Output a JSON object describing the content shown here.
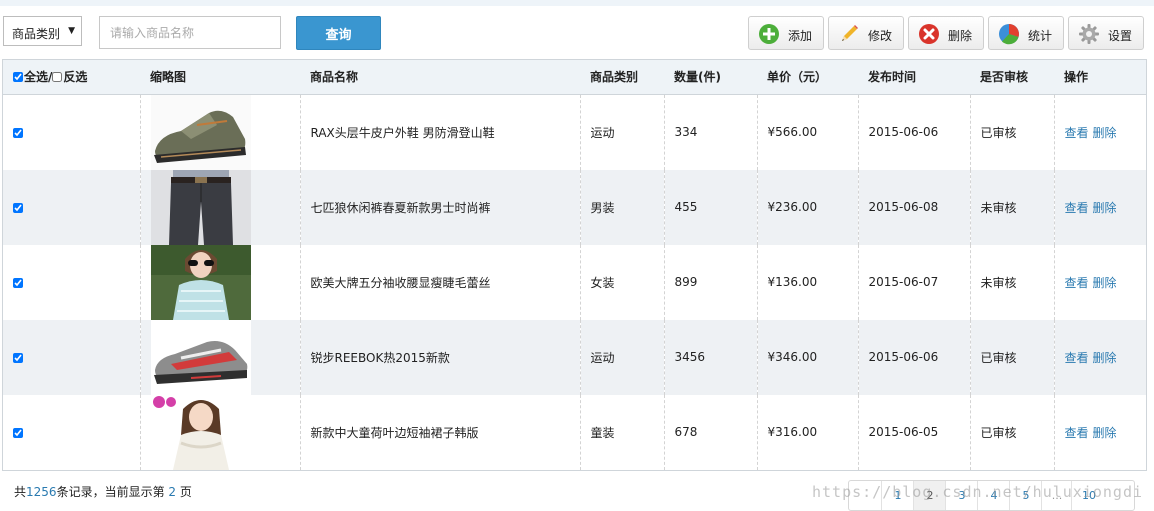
{
  "toolbar": {
    "category_select": {
      "value": "商品类别"
    },
    "search": {
      "placeholder": "请输入商品名称",
      "value": ""
    },
    "query_label": "查询",
    "buttons": [
      {
        "key": "add",
        "label": "添加",
        "icon": "plus-circle-icon"
      },
      {
        "key": "edit",
        "label": "修改",
        "icon": "pencil-icon"
      },
      {
        "key": "delete",
        "label": "删除",
        "icon": "x-circle-icon"
      },
      {
        "key": "stats",
        "label": "统计",
        "icon": "pie-chart-icon"
      },
      {
        "key": "settings",
        "label": "设置",
        "icon": "gear-icon"
      }
    ]
  },
  "table": {
    "headers": {
      "select_all": "全选/",
      "invert": "反选",
      "thumb": "缩略图",
      "name": "商品名称",
      "category": "商品类别",
      "qty": "数量(件)",
      "price": "单价（元）",
      "date": "发布时间",
      "audit": "是否审核",
      "ops": "操作"
    },
    "rows": [
      {
        "name": "RAX头层牛皮户外鞋 男防滑登山鞋",
        "category": "运动",
        "qty": "334",
        "price": "¥566.00",
        "date": "2015-06-06",
        "audit": "已审核",
        "view": "查看",
        "del": "删除"
      },
      {
        "name": "七匹狼休闲裤春夏新款男士时尚裤",
        "category": "男装",
        "qty": "455",
        "price": "¥236.00",
        "date": "2015-06-08",
        "audit": "未审核",
        "view": "查看",
        "del": "删除"
      },
      {
        "name": "欧美大牌五分袖收腰显瘦睫毛蕾丝",
        "category": "女装",
        "qty": "899",
        "price": "¥136.00",
        "date": "2015-06-07",
        "audit": "未审核",
        "view": "查看",
        "del": "删除"
      },
      {
        "name": "锐步REEBOK热2015新款",
        "category": "运动",
        "qty": "3456",
        "price": "¥346.00",
        "date": "2015-06-06",
        "audit": "已审核",
        "view": "查看",
        "del": "删除"
      },
      {
        "name": "新款中大童荷叶边短袖裙子韩版",
        "category": "童装",
        "qty": "678",
        "price": "¥316.00",
        "date": "2015-06-05",
        "audit": "已审核",
        "view": "查看",
        "del": "删除"
      }
    ]
  },
  "footer": {
    "prefix": "共",
    "total": "1256",
    "mid": "条记录，当前显示第",
    "current": "2",
    "suffix": "页"
  },
  "pagination": {
    "pages": [
      "1",
      "2",
      "3",
      "4",
      "5",
      "...",
      "10"
    ],
    "current": "2"
  },
  "watermark": "https://blog.csdn.net/huluxiongdi",
  "colors": {
    "accent": "#3a96d0",
    "link": "#2a7ab0",
    "header_bg": "#eef3f7"
  }
}
